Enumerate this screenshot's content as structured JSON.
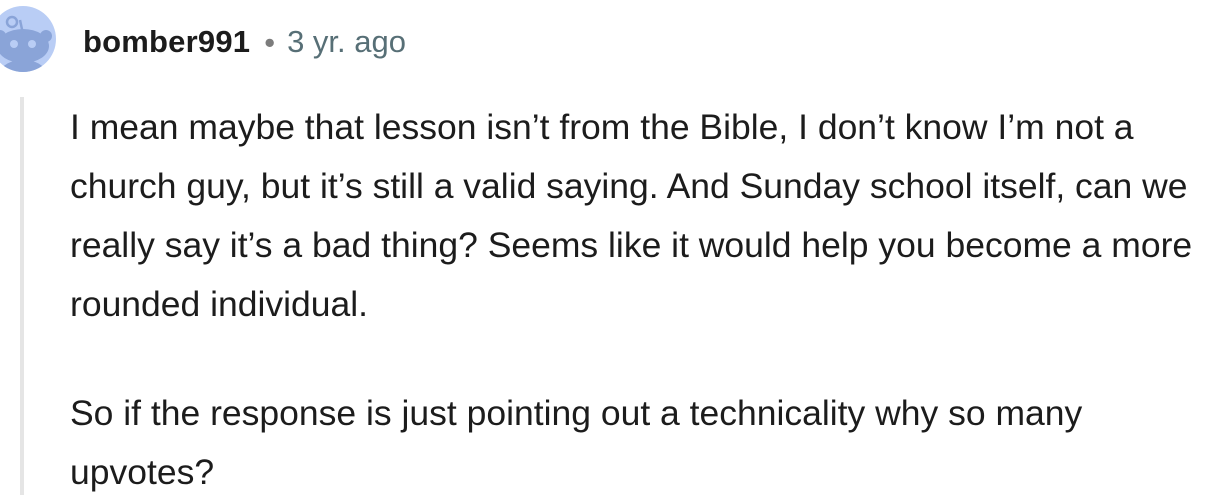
{
  "comment": {
    "author": "bomber991",
    "separator": "•",
    "timestamp": "3 yr. ago",
    "paragraphs": [
      "I mean maybe that lesson isn’t from the Bible, I don’t know I’m not a church guy, but it’s still a valid saying. And Sunday school itself, can we really say it’s a bad thing? Seems like it would help you become a more rounded individual.",
      "So if the response is just pointing out a technicality why so many upvotes?"
    ]
  },
  "colors": {
    "avatar_background": "#b9cdf5",
    "avatar_figure": "#8aa4d8",
    "username": "#1c1c1c",
    "timestamp": "#576f76",
    "thread_line": "#e5e5e5"
  },
  "icons": {
    "avatar": "default-snoo-avatar-icon"
  }
}
